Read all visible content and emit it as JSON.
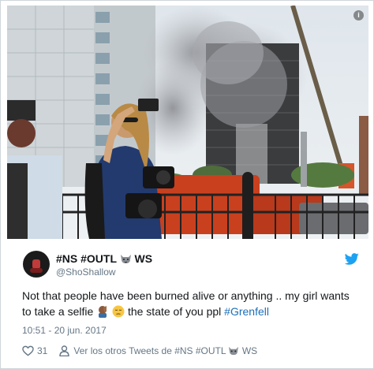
{
  "tweet": {
    "display_name": "#NS #OUTL",
    "display_name_suffix": "WS",
    "handle": "@ShoShallow",
    "text_part1": "Not that people have been burned alive or anything .. my girl wants to take a selfie ",
    "text_part2": " the state of you ppl ",
    "hashtag": "#Grenfell",
    "timestamp": "10:51 - 20 jun. 2017",
    "likes": "31",
    "more_tweets_prefix": "Ver los otros Tweets de #NS #OUTL",
    "more_tweets_suffix": "WS"
  },
  "icons": {
    "twitter": "bird-icon",
    "like": "heart-icon",
    "profile": "person-icon",
    "wolf": "wolf-emoji",
    "info": "info-icon"
  },
  "info_badge": "i",
  "colors": {
    "twitter_blue": "#1da1f2",
    "hashtag": "#1b6fb8",
    "meta_gray": "#657786",
    "text": "#14171a"
  }
}
